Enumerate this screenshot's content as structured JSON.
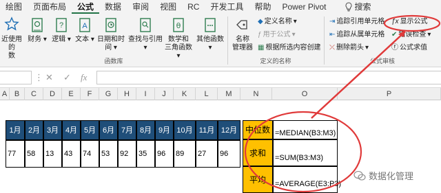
{
  "ribbon_tabs": [
    "绘图",
    "页面布局",
    "公式",
    "数据",
    "审阅",
    "视图",
    "RC",
    "开发工具",
    "帮助",
    "Power Pivot"
  ],
  "active_tab": "公式",
  "search_label": "搜索",
  "function_library": {
    "recent": "近使用的",
    "recent2": "数",
    "finance": "财务",
    "logic": "逻辑",
    "text": "文本",
    "datetime": "日期和时间",
    "lookup": "查找与引用",
    "math": "数学和",
    "math2": "三角函数",
    "more": "其他函数",
    "group_label": "函数库"
  },
  "defined_names": {
    "name_manager": "名称",
    "name_manager2": "管理器",
    "define_name": "定义名称",
    "use_in_formula": "用于公式",
    "create_from_selection": "根据所选内容创建",
    "group_label": "定义的名称"
  },
  "formula_auditing": {
    "trace_precedents": "追踪引用单元格",
    "trace_dependents": "追踪从属单元格",
    "remove_arrows": "删除箭头",
    "show_formulas": "显示公式",
    "error_checking": "错误检查",
    "evaluate_formula": "公式求值",
    "group_label": "公式审核"
  },
  "formula_bar": {
    "cancel": "✕",
    "enter": "✓",
    "fx": "fx"
  },
  "columns": [
    "A",
    "B",
    "C",
    "D",
    "E",
    "F",
    "G",
    "H",
    "I",
    "J",
    "K",
    "L",
    "M",
    "N",
    "O",
    "P"
  ],
  "months": [
    "1月",
    "2月",
    "3月",
    "4月",
    "5月",
    "6月",
    "7月",
    "8月",
    "9月",
    "10月",
    "11月",
    "12月"
  ],
  "values": [
    "77",
    "58",
    "13",
    "43",
    "74",
    "53",
    "92",
    "35",
    "96",
    "89",
    "27",
    "96"
  ],
  "stats": [
    {
      "label": "中位数",
      "formula": "=MEDIAN(B3:M3)"
    },
    {
      "label": "求和",
      "formula": "=SUM(B3:M3)"
    },
    {
      "label": "平均",
      "formula": "=AVERAGE(E3:P3)"
    }
  ],
  "watermark": "数据化管理",
  "colors": {
    "header_fill": "#1f4e79",
    "label_fill": "#ffc000",
    "annotation_red": "#e03a3a",
    "excel_green": "#217346"
  }
}
